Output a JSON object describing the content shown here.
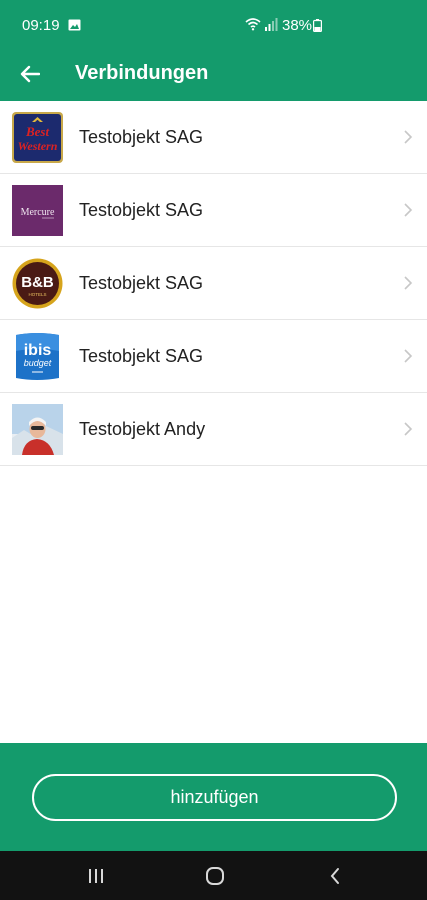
{
  "status_bar": {
    "time": "09:19",
    "battery": "38%",
    "icons": [
      "image-icon",
      "wifi-icon",
      "signal-icon",
      "battery-icon"
    ]
  },
  "app_bar": {
    "title": "Verbindungen",
    "back_icon": "arrow-back-icon"
  },
  "connections": [
    {
      "label": "Testobjekt SAG",
      "logo": "best-western-logo",
      "logo_text": "Best Western"
    },
    {
      "label": "Testobjekt SAG",
      "logo": "mercure-logo",
      "logo_text": "Mercure"
    },
    {
      "label": "Testobjekt SAG",
      "logo": "bb-hotels-logo",
      "logo_text": "B&B",
      "logo_subtext": "HOTELS"
    },
    {
      "label": "Testobjekt SAG",
      "logo": "ibis-budget-logo",
      "logo_text": "ibis",
      "logo_subtext": "budget"
    },
    {
      "label": "Testobjekt Andy",
      "logo": "avatar-photo",
      "logo_text": ""
    }
  ],
  "footer": {
    "add_label": "hinzufügen"
  },
  "colors": {
    "primary": "#149b6c",
    "nav_bar": "#121212"
  }
}
